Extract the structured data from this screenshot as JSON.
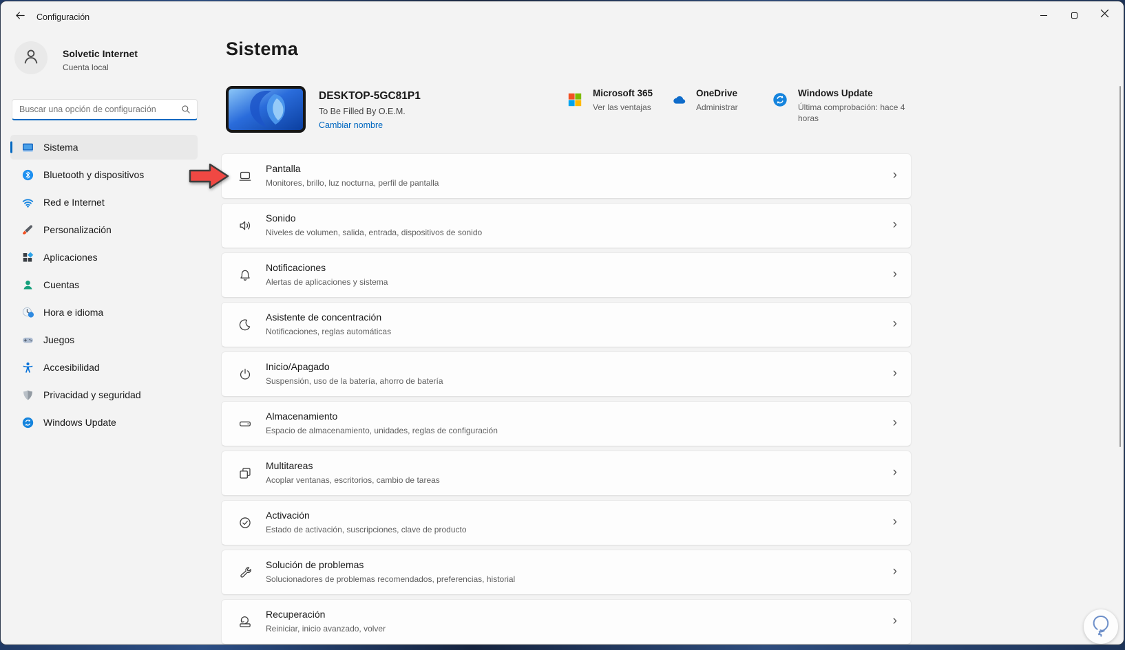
{
  "titlebar": {
    "title": "Configuración",
    "back_icon": "back-arrow-icon",
    "controls": [
      "minimize",
      "maximize",
      "close"
    ]
  },
  "sidebar": {
    "user": {
      "name": "Solvetic Internet",
      "account_type": "Cuenta local"
    },
    "search": {
      "placeholder": "Buscar una opción de configuración",
      "icon": "search-icon"
    },
    "items": [
      {
        "id": "sistema",
        "label": "Sistema",
        "icon": "system-icon",
        "selected": true
      },
      {
        "id": "bluetooth",
        "label": "Bluetooth y dispositivos",
        "icon": "bluetooth-icon",
        "selected": false
      },
      {
        "id": "red-internet",
        "label": "Red e Internet",
        "icon": "network-icon",
        "selected": false
      },
      {
        "id": "personalizacion",
        "label": "Personalización",
        "icon": "personalization-icon",
        "selected": false
      },
      {
        "id": "aplicaciones",
        "label": "Aplicaciones",
        "icon": "apps-icon",
        "selected": false
      },
      {
        "id": "cuentas",
        "label": "Cuentas",
        "icon": "accounts-icon",
        "selected": false
      },
      {
        "id": "hora-idioma",
        "label": "Hora e idioma",
        "icon": "time-language-icon",
        "selected": false
      },
      {
        "id": "juegos",
        "label": "Juegos",
        "icon": "gaming-icon",
        "selected": false
      },
      {
        "id": "accesibilidad",
        "label": "Accesibilidad",
        "icon": "accessibility-icon",
        "selected": false
      },
      {
        "id": "privacidad",
        "label": "Privacidad y seguridad",
        "icon": "privacy-icon",
        "selected": false
      },
      {
        "id": "windows-update",
        "label": "Windows Update",
        "icon": "windows-update-icon",
        "selected": false
      }
    ]
  },
  "main": {
    "page_title": "Sistema",
    "device": {
      "name": "DESKTOP-5GC81P1",
      "manufacturer": "To Be Filled By O.E.M.",
      "rename_link": "Cambiar nombre"
    },
    "promos": [
      {
        "id": "microsoft-365",
        "title": "Microsoft 365",
        "subtitle": "Ver las ventajas",
        "icon": "microsoft-365-icon",
        "subtitle_clickable": true
      },
      {
        "id": "onedrive",
        "title": "OneDrive",
        "subtitle": "Administrar",
        "icon": "onedrive-icon",
        "subtitle_clickable": true
      },
      {
        "id": "windows-update",
        "title": "Windows Update",
        "subtitle": "Última comprobación: hace 4 horas",
        "icon": "windows-update-icon",
        "subtitle_clickable": false
      }
    ],
    "settings": [
      {
        "id": "pantalla",
        "title": "Pantalla",
        "subtitle": "Monitores, brillo, luz nocturna, perfil de pantalla",
        "icon": "display-icon"
      },
      {
        "id": "sonido",
        "title": "Sonido",
        "subtitle": "Niveles de volumen, salida, entrada, dispositivos de sonido",
        "icon": "sound-icon"
      },
      {
        "id": "notificaciones",
        "title": "Notificaciones",
        "subtitle": "Alertas de aplicaciones y sistema",
        "icon": "notifications-icon"
      },
      {
        "id": "asistente-concentracion",
        "title": "Asistente de concentración",
        "subtitle": "Notificaciones, reglas automáticas",
        "icon": "focus-icon"
      },
      {
        "id": "inicio-apagado",
        "title": "Inicio/Apagado",
        "subtitle": "Suspensión, uso de la batería, ahorro de batería",
        "icon": "power-icon"
      },
      {
        "id": "almacenamiento",
        "title": "Almacenamiento",
        "subtitle": "Espacio de almacenamiento, unidades, reglas de configuración",
        "icon": "storage-icon"
      },
      {
        "id": "multitareas",
        "title": "Multitareas",
        "subtitle": "Acoplar ventanas, escritorios, cambio de tareas",
        "icon": "multitask-icon"
      },
      {
        "id": "activacion",
        "title": "Activación",
        "subtitle": "Estado de activación, suscripciones, clave de producto",
        "icon": "activation-icon"
      },
      {
        "id": "solucion-problemas",
        "title": "Solución de problemas",
        "subtitle": "Solucionadores de problemas recomendados, preferencias, historial",
        "icon": "troubleshoot-icon"
      },
      {
        "id": "recuperacion",
        "title": "Recuperación",
        "subtitle": "Reiniciar, inicio avanzado, volver",
        "icon": "recovery-icon"
      }
    ],
    "chevron": "›"
  },
  "overlay": {
    "pointer": "red-arrow-pointer",
    "badge": "lightbulb-badge"
  },
  "colors": {
    "accent": "#0067c0",
    "link": "#0067c0",
    "arrow_fill": "#f04843",
    "window_bg": "#f3f3f3",
    "card_bg": "#fdfdfd"
  }
}
